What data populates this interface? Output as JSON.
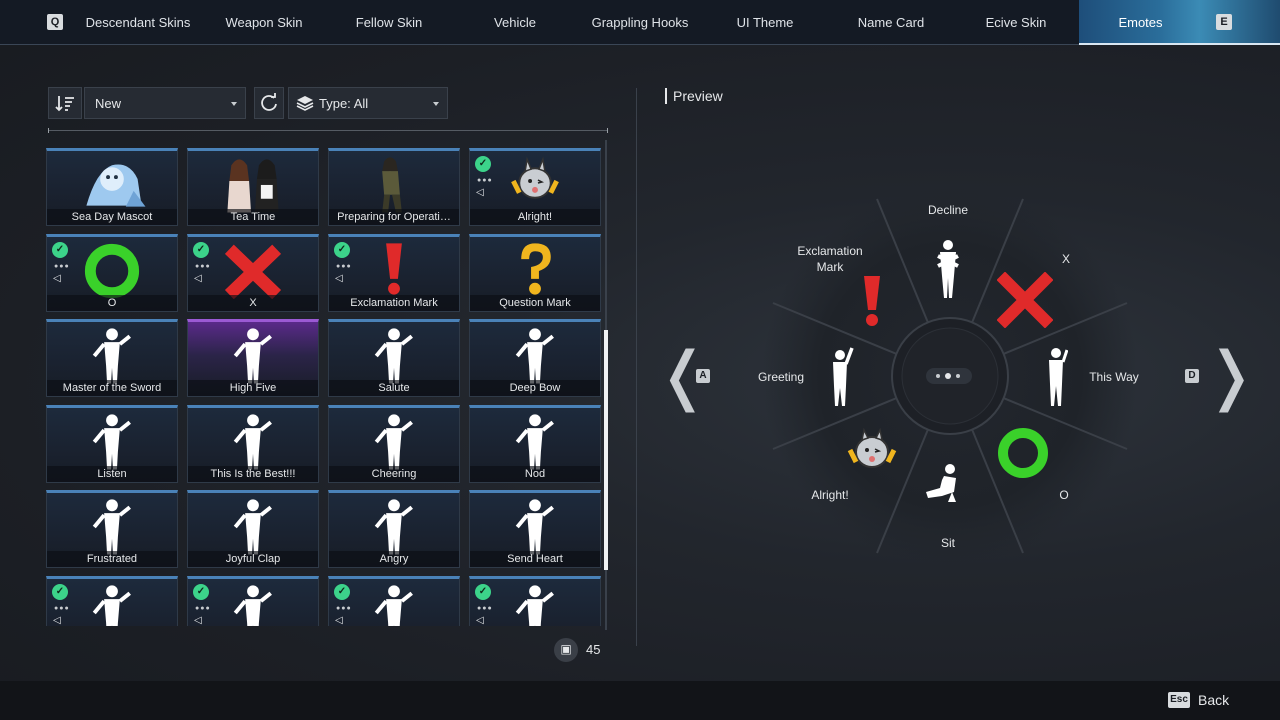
{
  "tabs": {
    "prev_key": "Q",
    "next_key": "E",
    "items": [
      "Descendant Skins",
      "Weapon Skin",
      "Fellow Skin",
      "Vehicle",
      "Grappling Hooks",
      "UI Theme",
      "Name Card",
      "Ecive Skin",
      "Emotes"
    ],
    "active": "Emotes"
  },
  "toolbar": {
    "sort_icon": "sort-icon",
    "sort_value": "New",
    "reset_icon": "refresh-icon",
    "type_icon": "layers-icon",
    "type_value": "Type: All"
  },
  "emotes": [
    {
      "label": "Sea Day Mascot",
      "equipped": false,
      "art": "mascot"
    },
    {
      "label": "Tea Time",
      "equipped": false,
      "art": "duo"
    },
    {
      "label": "Preparing for Operati…",
      "equipped": false,
      "art": "soldier"
    },
    {
      "label": "Alright!",
      "equipped": true,
      "art": "sticker"
    },
    {
      "label": "O",
      "equipped": true,
      "art": "circle"
    },
    {
      "label": "X",
      "equipped": true,
      "art": "cross"
    },
    {
      "label": "Exclamation Mark",
      "equipped": true,
      "art": "exclaim"
    },
    {
      "label": "Question Mark",
      "equipped": false,
      "art": "question"
    },
    {
      "label": "Master of the Sword",
      "equipped": false,
      "art": "figure"
    },
    {
      "label": "High Five",
      "equipped": false,
      "art": "figure"
    },
    {
      "label": "Salute",
      "equipped": false,
      "art": "figure"
    },
    {
      "label": "Deep Bow",
      "equipped": false,
      "art": "figure"
    },
    {
      "label": "Listen",
      "equipped": false,
      "art": "figure"
    },
    {
      "label": "This Is the Best!!!",
      "equipped": false,
      "art": "figure"
    },
    {
      "label": "Cheering",
      "equipped": false,
      "art": "figure"
    },
    {
      "label": "Nod",
      "equipped": false,
      "art": "figure"
    },
    {
      "label": "Frustrated",
      "equipped": false,
      "art": "figure"
    },
    {
      "label": "Joyful Clap",
      "equipped": false,
      "art": "figure"
    },
    {
      "label": "Angry",
      "equipped": false,
      "art": "figure"
    },
    {
      "label": "Send Heart",
      "equipped": false,
      "art": "figure"
    },
    {
      "label": "",
      "equipped": true,
      "art": "figure"
    },
    {
      "label": "",
      "equipped": true,
      "art": "figure"
    },
    {
      "label": "",
      "equipped": true,
      "art": "figure"
    },
    {
      "label": "",
      "equipped": true,
      "art": "figure"
    }
  ],
  "owned_count": "45",
  "preview": {
    "title": "Preview",
    "wheel": {
      "decline": "Decline",
      "x": "X",
      "exclamation": "Exclamation Mark",
      "this_way": "This Way",
      "greeting": "Greeting",
      "o": "O",
      "alright": "Alright!",
      "sit": "Sit"
    },
    "prev_key": "A",
    "next_key": "D"
  },
  "footer": {
    "esc_key": "Esc",
    "back_label": "Back"
  },
  "colors": {
    "accent": "#4a82b8",
    "equipped": "#3cd38a",
    "circle": "#3ad12a",
    "cross": "#e02a2a",
    "question": "#f0b51e"
  }
}
